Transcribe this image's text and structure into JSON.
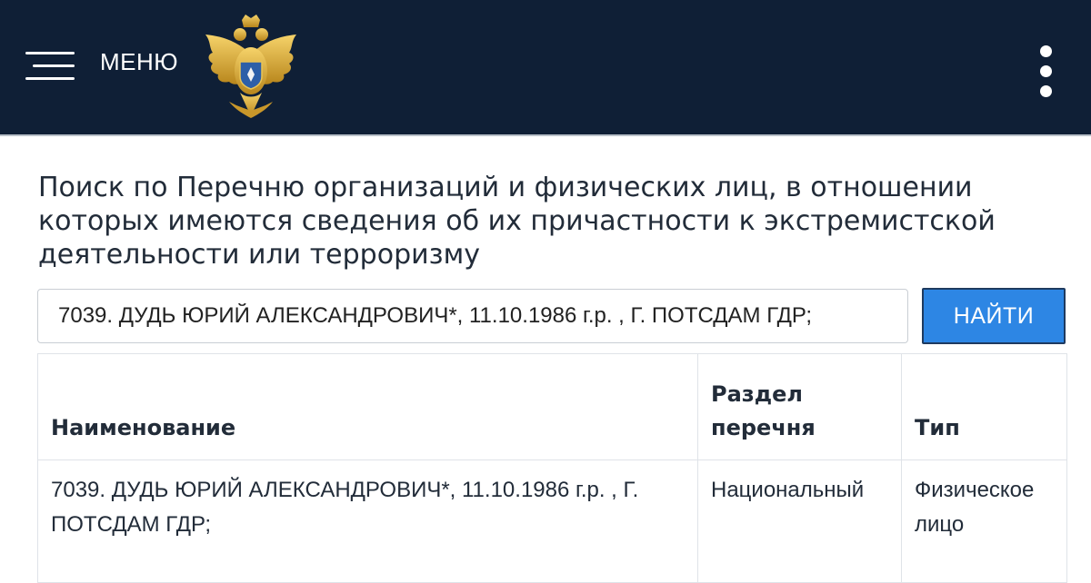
{
  "header": {
    "menu_label": "МЕНЮ",
    "emblem_icon": "double-headed-eagle-emblem",
    "background_color": "#0f1f36"
  },
  "main": {
    "title": "Поиск по Перечню организаций и физических лиц, в отношении которых имеются сведения об их причастности к экстремистской деятельности или терроризму",
    "search": {
      "value": "7039. ДУДЬ ЮРИЙ АЛЕКСАНДРОВИЧ*, 11.10.1986 г.р. , Г. ПОТСДАМ ГДР;",
      "button_label": "НАЙТИ",
      "button_color": "#2d86e4"
    },
    "table": {
      "headers": {
        "name": "Наименование",
        "section": "Раздел перечня",
        "type": "Тип"
      },
      "rows": [
        {
          "name": "7039. ДУДЬ ЮРИЙ АЛЕКСАНДРОВИЧ*, 11.10.1986 г.р. , Г. ПОТСДАМ ГДР;",
          "section": "Национальный",
          "type": "Физическое лицо"
        }
      ]
    }
  }
}
